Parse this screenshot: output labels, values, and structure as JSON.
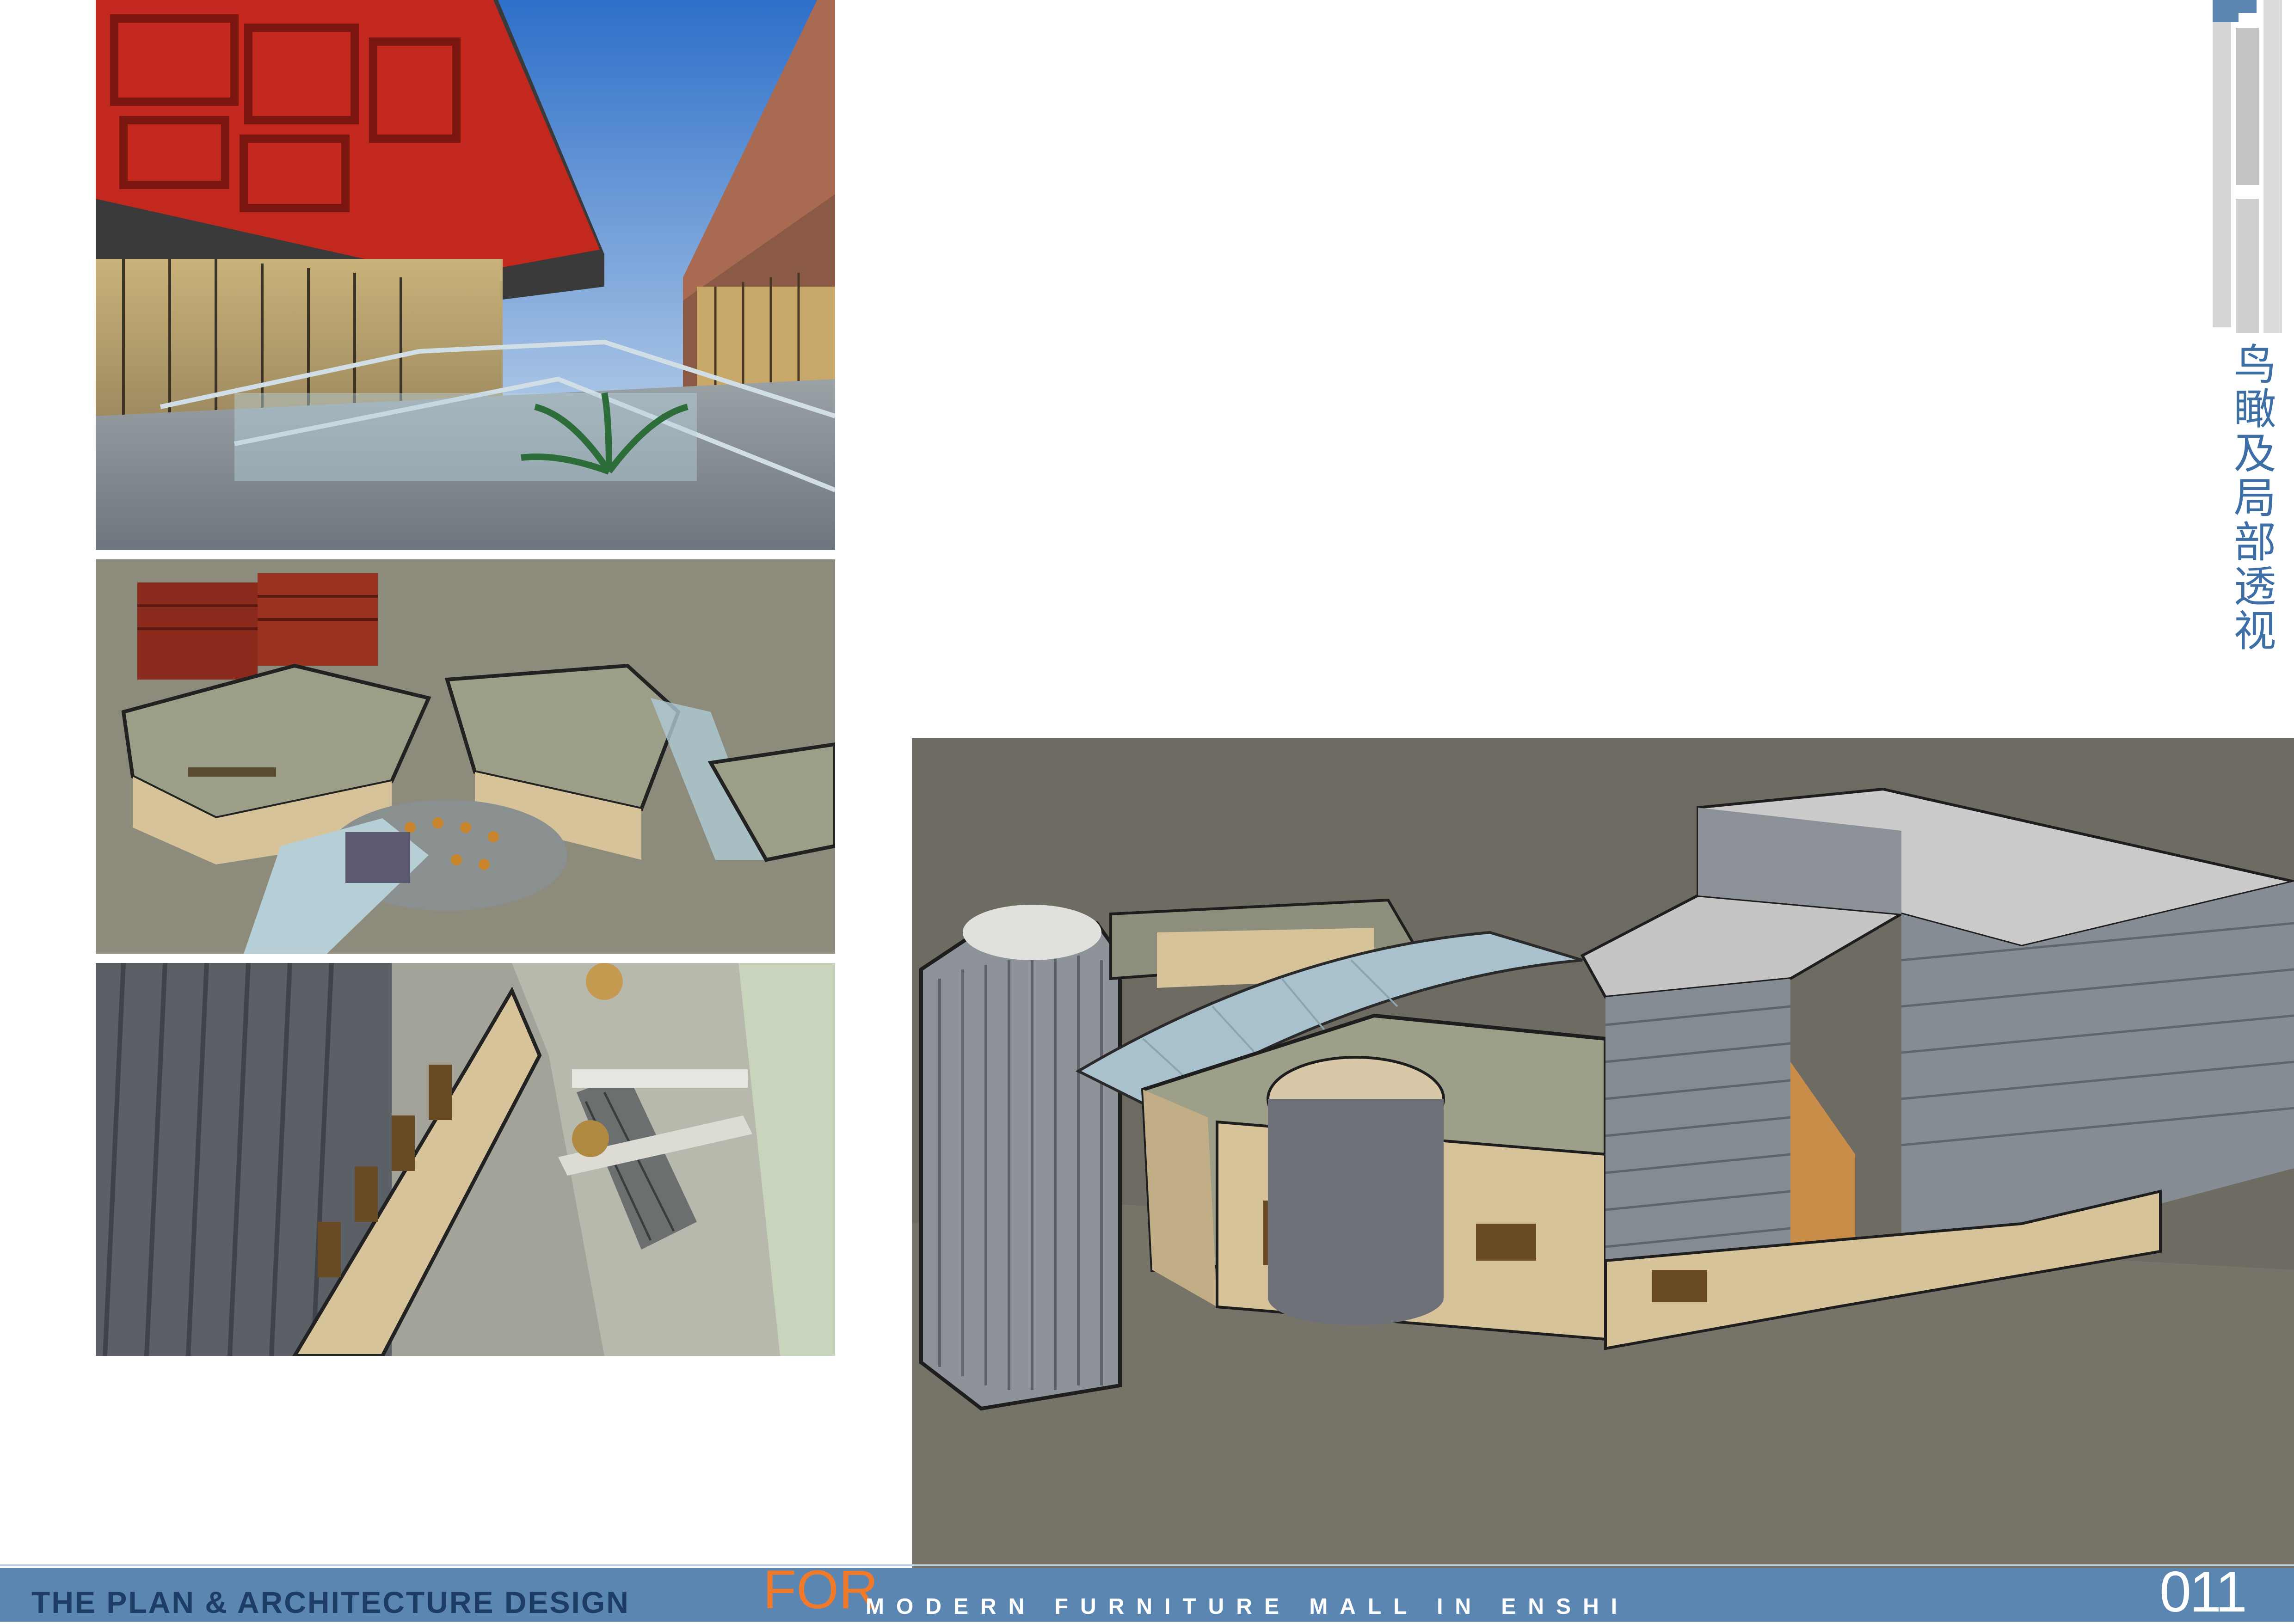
{
  "section_title": "鸟瞰及局部透视",
  "footer": {
    "left_text": "THE PLAN & ARCHITECTURE DESIGN",
    "for_text": "FOR",
    "right_text": "MODERN FURNITURE MALL IN ENSHI",
    "page_number": "011"
  },
  "colors": {
    "footer_bar": "#5c86b2",
    "accent_orange": "#f07a2a",
    "title_blue": "#3d6fa6",
    "sky": "#4e8ed8",
    "red_facade": "#c2281e",
    "ground_grey": "#6e6c62"
  },
  "images": [
    {
      "name": "street-perspective"
    },
    {
      "name": "plaza-aerial"
    },
    {
      "name": "escalator-view"
    },
    {
      "name": "mall-aerial"
    }
  ]
}
